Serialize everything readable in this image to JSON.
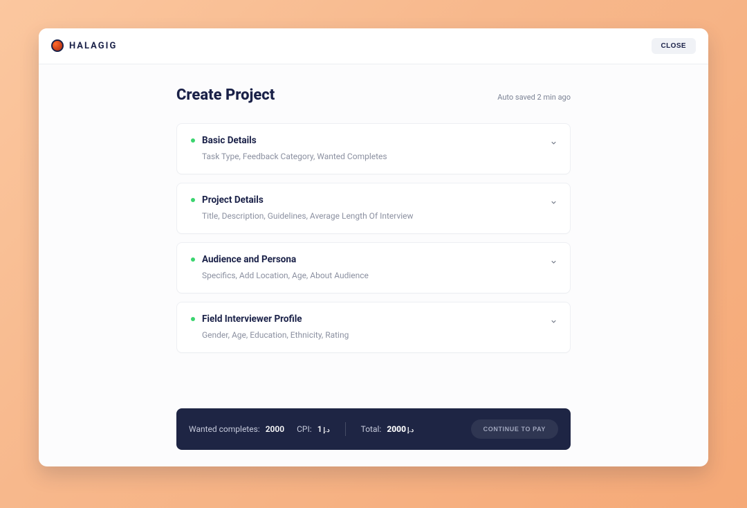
{
  "header": {
    "brand": "HALAGIG",
    "close_label": "CLOSE"
  },
  "page": {
    "title": "Create Project",
    "autosave": "Auto saved 2 min ago"
  },
  "sections": [
    {
      "title": "Basic Details",
      "subtitle": "Task Type, Feedback Category, Wanted Completes",
      "status": "complete"
    },
    {
      "title": "Project Details",
      "subtitle": "Title, Description, Guidelines, Average Length Of Interview",
      "status": "complete"
    },
    {
      "title": "Audience and Persona",
      "subtitle": "Specifics, Add Location, Age, About Audience",
      "status": "complete"
    },
    {
      "title": "Field Interviewer Profile",
      "subtitle": "Gender, Age, Education, Ethnicity, Rating",
      "status": "complete"
    }
  ],
  "footer": {
    "wanted_label": "Wanted completes:",
    "wanted_value": "2000",
    "cpi_label": "CPI:",
    "cpi_value": "1",
    "cpi_currency": "د.إ",
    "total_label": "Total:",
    "total_value": "2000",
    "total_currency": "د.إ",
    "continue_label": "CONTINUE TO PAY"
  }
}
